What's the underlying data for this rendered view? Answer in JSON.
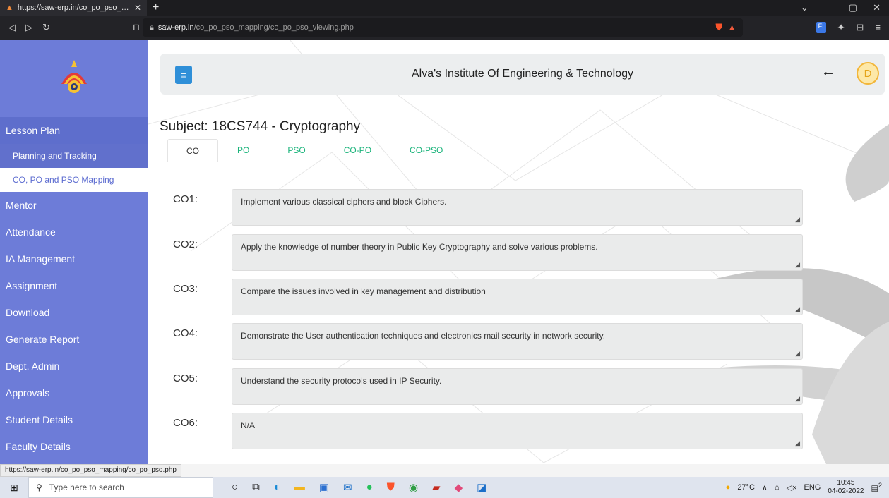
{
  "browser": {
    "tab_title": "https://saw-erp.in/co_po_pso_mappi",
    "url_host": "saw-erp.in",
    "url_path": "/co_po_pso_mapping/co_po_pso_viewing.php"
  },
  "header": {
    "institute": "Alva's Institute Of Engineering & Technology",
    "avatar_letter": "D"
  },
  "sidebar": {
    "items": [
      {
        "label": "Lesson Plan"
      },
      {
        "label": "Planning and Tracking"
      },
      {
        "label": "CO, PO and PSO Mapping"
      },
      {
        "label": "Mentor"
      },
      {
        "label": "Attendance"
      },
      {
        "label": "IA Management"
      },
      {
        "label": "Assignment"
      },
      {
        "label": "Download"
      },
      {
        "label": "Generate Report"
      },
      {
        "label": "Dept. Admin"
      },
      {
        "label": "Approvals"
      },
      {
        "label": "Student Details"
      },
      {
        "label": "Faculty Details"
      }
    ]
  },
  "main": {
    "subject": "Subject: 18CS744 - Cryptography",
    "tabs": [
      "CO",
      "PO",
      "PSO",
      "CO-PO",
      "CO-PSO"
    ],
    "cos": [
      {
        "label": "CO1:",
        "text": "Implement various classical ciphers and block Ciphers."
      },
      {
        "label": "CO2:",
        "text": "Apply the knowledge of number theory in Public Key Cryptography and solve various problems."
      },
      {
        "label": "CO3:",
        "text": "Compare the  issues involved in key management and distribution"
      },
      {
        "label": "CO4:",
        "text": "Demonstrate the User authentication techniques and electronics mail security in network security."
      },
      {
        "label": "CO5:",
        "text": "Understand the security protocols used in IP Security."
      },
      {
        "label": "CO6:",
        "text": "N/A"
      }
    ]
  },
  "status_link": "https://saw-erp.in/co_po_pso_mapping/co_po_pso.php",
  "taskbar": {
    "search_placeholder": "Type here to search",
    "temperature": "27°C",
    "lang": "ENG",
    "time": "10:45",
    "date": "04-02-2022",
    "notif_count": "2"
  }
}
